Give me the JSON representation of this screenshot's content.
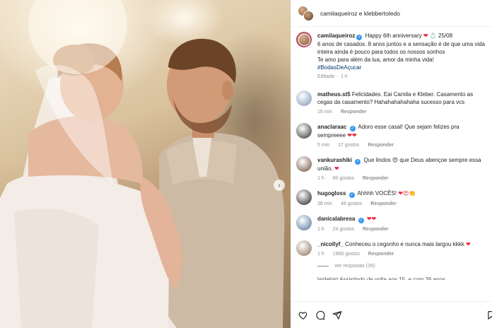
{
  "post": {
    "author_header": "camilaqueiroz e klebbertoledo"
  },
  "caption": {
    "username": "camilaqueiroz",
    "line1": "Happy 6th anniversary",
    "line1_suffix": "25/08",
    "line2": "6 anos de casados. 8 anos juntos e a sensação é de que uma vida inteira ainda é pouco para todos os nossos sonhos",
    "line3": "Te amo para além da lua, amor da minha vida!",
    "hashtag": "#BodasDeAçucar",
    "meta_edited": "Editada",
    "meta_time": "1 h"
  },
  "comments": [
    {
      "username": "matheus.st5",
      "verified": false,
      "text": "Felicidades. Eai Camila e Kleber. Casamento as cegas da casamento? Hahahahahahaha sucesso para vcs",
      "emojis": "",
      "time": "16 min",
      "likes": "",
      "reply": "Responder",
      "avatar_color": "#7a93b3"
    },
    {
      "username": "anaclaraac",
      "verified": true,
      "text": "Adoro esse casal! Que sejam felizes pra sempreeee",
      "emojis": "❤❤",
      "time": "5 min",
      "likes": "17 gostos",
      "reply": "Responder",
      "avatar_color": "#2b2b2b"
    },
    {
      "username": "vankurashiki",
      "verified": true,
      "text": "Que lindos 😍 que Deus abençoe sempre essa união.",
      "emojis": "❤",
      "time": "1 h",
      "likes": "60 gostos",
      "reply": "Responder",
      "avatar_color": "#6a4a3a"
    },
    {
      "username": "hugogloss",
      "verified": true,
      "text": "Ahhhh VOCÊS!",
      "emojis": "❤😍👏",
      "time": "38 min",
      "likes": "48 gostos",
      "reply": "Responder",
      "avatar_color": "#1b1b1b"
    },
    {
      "username": "danicalabresa",
      "verified": true,
      "text": "",
      "emojis": "❤❤",
      "time": "1 h",
      "likes": "24 gostos",
      "reply": "Responder",
      "avatar_color": "#4b6f96"
    },
    {
      "username": "_nicollyf_",
      "verified": false,
      "text": "Conheceu o cegonho e nunca mais largou kkkk",
      "emojis": "❤",
      "time": "1 h",
      "likes": "1966 gostos",
      "reply": "Responder",
      "avatar_color": "#8b6f5a"
    }
  ],
  "view_replies": "Ver respostas (28)",
  "next_comment_partial": "laidebist Assistindo de volta aos 15, e com 26 anos",
  "icons": {
    "like": "heart-outline-icon",
    "comment": "speech-bubble-icon",
    "share": "paper-plane-icon",
    "save": "bookmark-icon",
    "next": "chevron-right-icon",
    "verified": "verified-badge-icon"
  },
  "colors": {
    "verified": "#3897f0",
    "heart": "#ed2a3b",
    "muted": "#8e8e8e",
    "hashtag": "#00376b"
  }
}
